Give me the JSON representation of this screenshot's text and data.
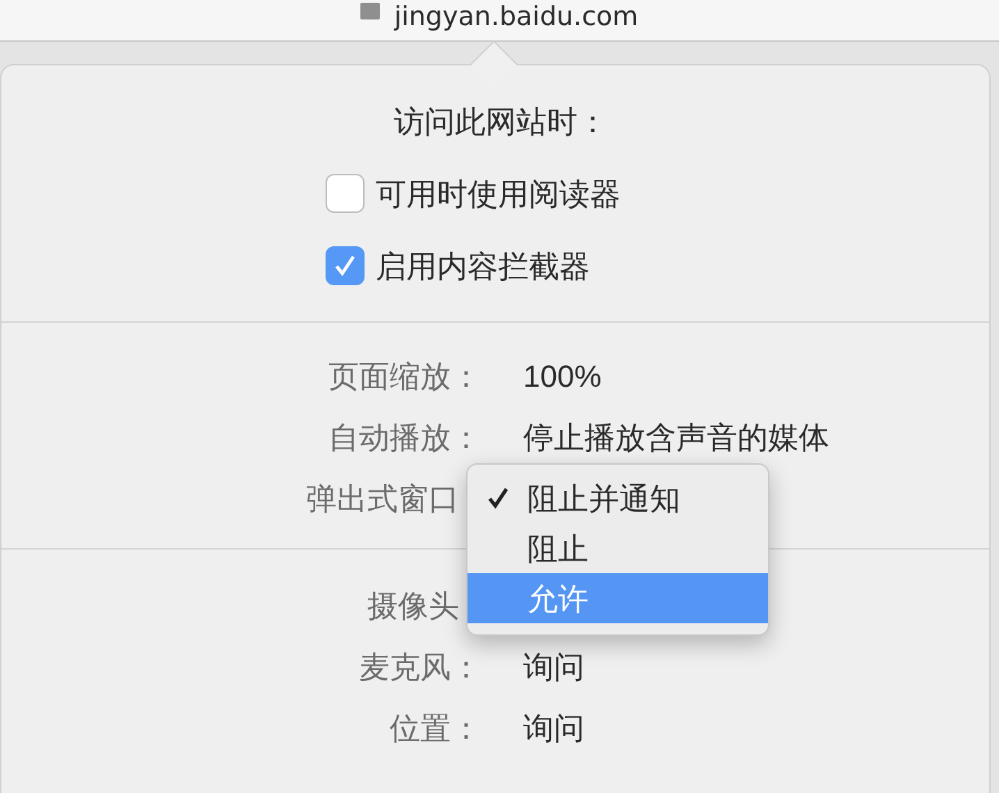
{
  "address_bar": {
    "url": "jingyan.baidu.com"
  },
  "popover": {
    "heading": "访问此网站时：",
    "options": [
      {
        "label": "可用时使用阅读器",
        "checked": false
      },
      {
        "label": "启用内容拦截器",
        "checked": true
      }
    ],
    "settings": [
      {
        "label": "页面缩放：",
        "value": "100%"
      },
      {
        "label": "自动播放：",
        "value": "停止播放含声音的媒体"
      },
      {
        "label": "弹出式窗口",
        "kind": "menu",
        "menu": [
          {
            "label": "阻止并通知",
            "selected": true,
            "highlighted": false
          },
          {
            "label": "阻止",
            "selected": false,
            "highlighted": false
          },
          {
            "label": "允许",
            "selected": false,
            "highlighted": true
          }
        ]
      }
    ],
    "permissions": [
      {
        "label": "摄像头",
        "kind": "covered"
      },
      {
        "label": "麦克风：",
        "value": "询问"
      },
      {
        "label": "位置：",
        "value": "询问"
      }
    ]
  }
}
